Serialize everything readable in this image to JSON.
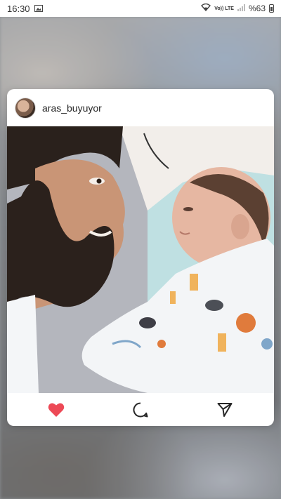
{
  "status_bar": {
    "time": "16:30",
    "network": "Vo)) LTE",
    "battery": "%63"
  },
  "post": {
    "username": "aras_buyuyor",
    "avatar_icon": "profile-photo",
    "image_description_icon": "post-photo",
    "actions": {
      "like_icon": "heart-icon",
      "like_color": "#ed4956",
      "comment_icon": "comment-icon",
      "share_icon": "send-icon"
    }
  }
}
